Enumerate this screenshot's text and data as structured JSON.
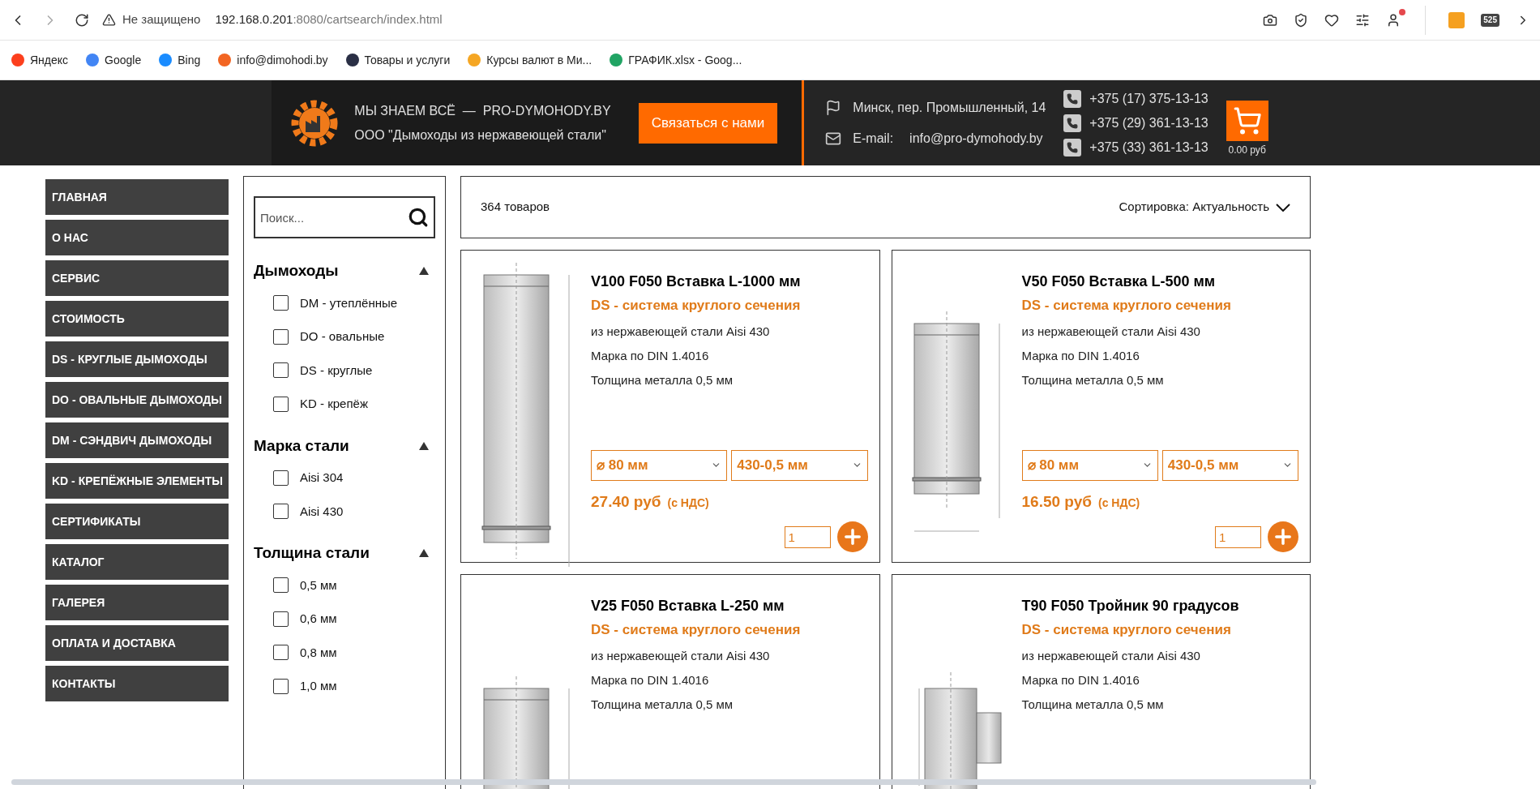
{
  "browser": {
    "security_label": "Не защищено",
    "url_host": "192.168.0.201",
    "url_path": ":8080/cartsearch/index.html",
    "extension_badge": "525"
  },
  "bookmarks": [
    {
      "label": "Яндекс",
      "color": "#fc3f1d"
    },
    {
      "label": "Google",
      "color": "#4285f4"
    },
    {
      "label": "Bing",
      "color": "#1a8cff"
    },
    {
      "label": "info@dimohodi.by",
      "color": "#f26522"
    },
    {
      "label": "Товары и услуги",
      "color": "#2a2f45"
    },
    {
      "label": "Курсы валют в Ми...",
      "color": "#f5a623"
    },
    {
      "label": "ГРАФИК.xlsx - Goog...",
      "color": "#21a464"
    }
  ],
  "header": {
    "slogan": "МЫ ЗНАЕМ ВСЁ  —  PRO-DYMOHODY.BY",
    "company": "ООО \"Дымоходы из нержавеющей стали\"",
    "contact_button": "Связаться с нами",
    "address": "Минск, пер. Промышленный, 14",
    "email_label": "E-mail:",
    "email": "info@pro-dymohody.by",
    "phones": [
      "+375 (17) 375-13-13",
      "+375 (29) 361-13-13",
      "+375 (33) 361-13-13"
    ],
    "cart_total": "0.00 руб"
  },
  "menu": [
    {
      "label": "ГЛАВНАЯ"
    },
    {
      "label": "О НАС"
    },
    {
      "label": "СЕРВИС"
    },
    {
      "label": "СТОИМОСТЬ"
    },
    {
      "label": "DS - КРУГЛЫЕ ДЫМОХОДЫ"
    },
    {
      "label": "DO - ОВАЛЬНЫЕ ДЫМОХОДЫ"
    },
    {
      "label": "DM - СЭНДВИЧ ДЫМОХОДЫ"
    },
    {
      "label": "KD - КРЕПЁЖНЫЕ ЭЛЕМЕНТЫ"
    },
    {
      "label": "СЕРТИФИКАТЫ"
    },
    {
      "label": "КАТАЛОГ"
    },
    {
      "label": "ГАЛЕРЕЯ"
    },
    {
      "label": "ОПЛАТА И ДОСТАВКА"
    },
    {
      "label": "КОНТАКТЫ"
    }
  ],
  "filters": {
    "search_placeholder": "Поиск...",
    "groups": [
      {
        "title": "Дымоходы",
        "expanded": true,
        "options": [
          {
            "label": "DM - утеплённые",
            "checked": false
          },
          {
            "label": "DO - овальные",
            "checked": false
          },
          {
            "label": "DS - круглые",
            "checked": false
          },
          {
            "label": "KD - крепёж",
            "checked": false
          }
        ]
      },
      {
        "title": "Марка стали",
        "expanded": true,
        "options": [
          {
            "label": "Aisi 304",
            "checked": false
          },
          {
            "label": "Aisi 430",
            "checked": false
          }
        ]
      },
      {
        "title": "Толщина стали",
        "expanded": true,
        "options": [
          {
            "label": "0,5 мм",
            "checked": false
          },
          {
            "label": "0,6 мм",
            "checked": false
          },
          {
            "label": "0,8 мм",
            "checked": false
          },
          {
            "label": "1,0 мм",
            "checked": false
          }
        ]
      }
    ]
  },
  "results": {
    "count": "364 товаров",
    "sort": "Сортировка: Актуальность"
  },
  "products": [
    {
      "kind": "pipe-long",
      "title": "V100 F050 Вставка L-1000 мм",
      "series": "DS - система круглого сечения",
      "lines": [
        "из нержавеющей стали Aisi 430",
        "Марка по DIN 1.4016",
        "Толщина металла 0,5 мм"
      ],
      "diameter": "⌀ 80 мм",
      "steel": "430-0,5 мм",
      "price": "27.40 руб",
      "vat": "(с НДС)",
      "qty": "1"
    },
    {
      "kind": "pipe-medium",
      "title": "V50 F050 Вставка L-500 мм",
      "series": "DS - система круглого сечения",
      "lines": [
        "из нержавеющей стали Aisi 430",
        "Марка по DIN 1.4016",
        "Толщина металла 0,5 мм"
      ],
      "diameter": "⌀ 80 мм",
      "steel": "430-0,5 мм",
      "price": "16.50 руб",
      "vat": "(с НДС)",
      "qty": "1"
    },
    {
      "kind": "pipe-short",
      "title": "V25 F050 Вставка L-250 мм",
      "series": "DS - система круглого сечения",
      "lines": [
        "из нержавеющей стали Aisi 430",
        "Марка по DIN 1.4016",
        "Толщина металла 0,5 мм"
      ]
    },
    {
      "kind": "tee",
      "title": "T90 F050 Тройник 90 градусов",
      "series": "DS - система круглого сечения",
      "lines": [
        "из нержавеющей стали Aisi 430",
        "Марка по DIN 1.4016",
        "Толщина металла 0,5 мм"
      ]
    }
  ]
}
